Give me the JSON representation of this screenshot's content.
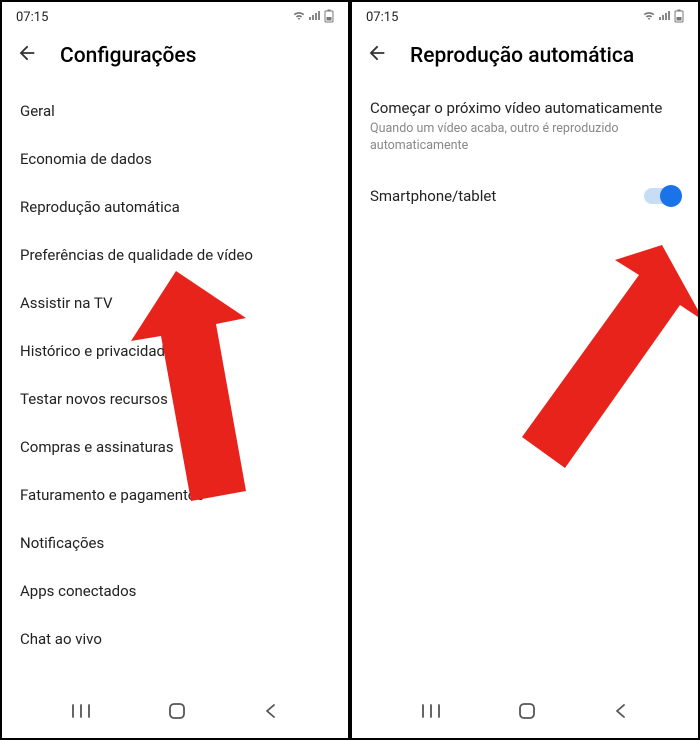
{
  "status": {
    "time": "07:15",
    "signal": "⋮",
    "wifi": "᯾",
    "battery": "▯"
  },
  "left": {
    "header_title": "Configurações",
    "items": [
      "Geral",
      "Economia de dados",
      "Reprodução automática",
      "Preferências de qualidade de vídeo",
      "Assistir na TV",
      "Histórico e privacidade",
      "Testar novos recursos",
      "Compras e assinaturas",
      "Faturamento e pagamentos",
      "Notificações",
      "Apps conectados",
      "Chat ao vivo"
    ]
  },
  "right": {
    "header_title": "Reprodução automática",
    "section_title": "Começar o próximo vídeo automaticamente",
    "section_subtitle": "Quando um vídeo acaba, outro é reproduzido automaticamente",
    "toggle_label": "Smartphone/tablet",
    "toggle_on": true
  },
  "colors": {
    "arrow": "#e8231b",
    "toggle_on": "#1a73e8",
    "toggle_track": "#c7dcf5"
  }
}
